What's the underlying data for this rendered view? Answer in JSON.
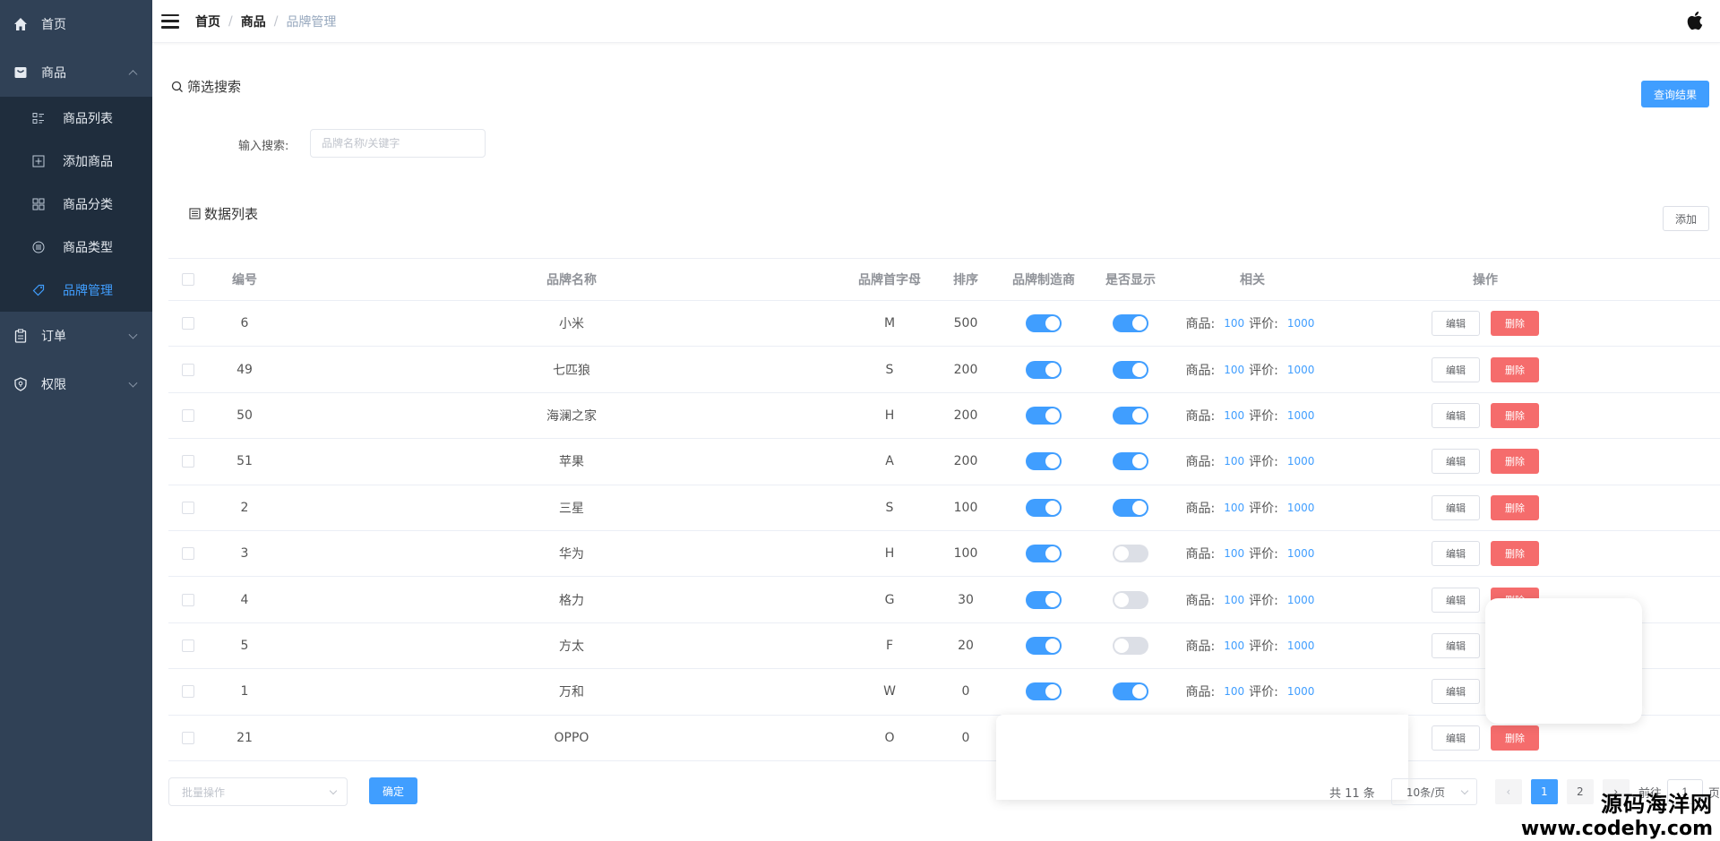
{
  "sidebar": {
    "items": [
      {
        "label": "首页",
        "icon": "home-icon"
      },
      {
        "label": "商品",
        "icon": "shop-bag-icon",
        "expanded": true
      },
      {
        "label": "订单",
        "icon": "order-clipboard-icon",
        "expanded": false
      },
      {
        "label": "权限",
        "icon": "shield-icon",
        "expanded": false
      }
    ],
    "sub_items": [
      {
        "label": "商品列表",
        "icon": "list-icon"
      },
      {
        "label": "添加商品",
        "icon": "add-square-icon"
      },
      {
        "label": "商品分类",
        "icon": "grid-icon"
      },
      {
        "label": "商品类型",
        "icon": "list-circle-icon"
      },
      {
        "label": "品牌管理",
        "icon": "tag-icon",
        "active": true
      }
    ]
  },
  "header": {
    "breadcrumb": [
      "首页",
      "商品",
      "品牌管理"
    ],
    "separator": "/"
  },
  "search": {
    "title": "筛选搜索",
    "label": "输入搜索:",
    "placeholder": "品牌名称/关键字",
    "query_button": "查询结果"
  },
  "data_list": {
    "title": "数据列表",
    "add_button": "添加"
  },
  "table": {
    "columns": [
      "编号",
      "品牌名称",
      "品牌首字母",
      "排序",
      "品牌制造商",
      "是否显示",
      "相关",
      "操作"
    ],
    "rows": [
      {
        "id": "6",
        "name": "小米",
        "letter": "M",
        "sort": "500",
        "maker": true,
        "show": true
      },
      {
        "id": "49",
        "name": "七匹狼",
        "letter": "S",
        "sort": "200",
        "maker": true,
        "show": true
      },
      {
        "id": "50",
        "name": "海澜之家",
        "letter": "H",
        "sort": "200",
        "maker": true,
        "show": true
      },
      {
        "id": "51",
        "name": "苹果",
        "letter": "A",
        "sort": "200",
        "maker": true,
        "show": true
      },
      {
        "id": "2",
        "name": "三星",
        "letter": "S",
        "sort": "100",
        "maker": true,
        "show": true
      },
      {
        "id": "3",
        "name": "华为",
        "letter": "H",
        "sort": "100",
        "maker": true,
        "show": false
      },
      {
        "id": "4",
        "name": "格力",
        "letter": "G",
        "sort": "30",
        "maker": true,
        "show": false
      },
      {
        "id": "5",
        "name": "方太",
        "letter": "F",
        "sort": "20",
        "maker": true,
        "show": false
      },
      {
        "id": "1",
        "name": "万和",
        "letter": "W",
        "sort": "0",
        "maker": true,
        "show": true
      },
      {
        "id": "21",
        "name": "OPPO",
        "letter": "O",
        "sort": "0",
        "maker": true,
        "show": true
      }
    ],
    "related_goods_label": "商品:",
    "related_goods_count": "100",
    "related_review_label": "评价:",
    "related_review_count": "1000",
    "edit_label": "编辑",
    "delete_label": "删除"
  },
  "footer": {
    "batch_placeholder": "批量操作",
    "confirm_button": "确定",
    "total_text": "共 11 条",
    "page_size": "10条/页",
    "pages": [
      "1",
      "2"
    ],
    "current_page": "1",
    "goto_label": "前往",
    "goto_value": "1",
    "page_suffix": "页"
  },
  "watermark": {
    "line1": "源码海洋网",
    "line2": "www.codehy.com"
  },
  "colors": {
    "sidebar_bg": "#304156",
    "submenu_bg": "#1f2d3d",
    "primary": "#409eff",
    "danger": "#f56c6c"
  }
}
